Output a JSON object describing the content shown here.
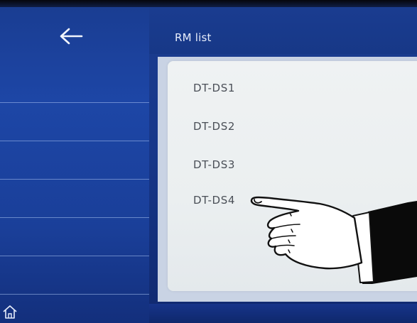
{
  "header": {
    "title": "RM list"
  },
  "icons": {
    "back": "arrow-left-icon",
    "home": "home-icon",
    "pointer": "pointing-hand"
  },
  "list": {
    "items": [
      {
        "label": "DT-DS1"
      },
      {
        "label": "DT-DS2"
      },
      {
        "label": "DT-DS3"
      },
      {
        "label": "DT-DS4"
      }
    ]
  },
  "colors": {
    "sidebar": "#1d46a6",
    "panel": "#eceff0",
    "item_text": "#4a4f57",
    "title_text": "#e8eefc"
  }
}
